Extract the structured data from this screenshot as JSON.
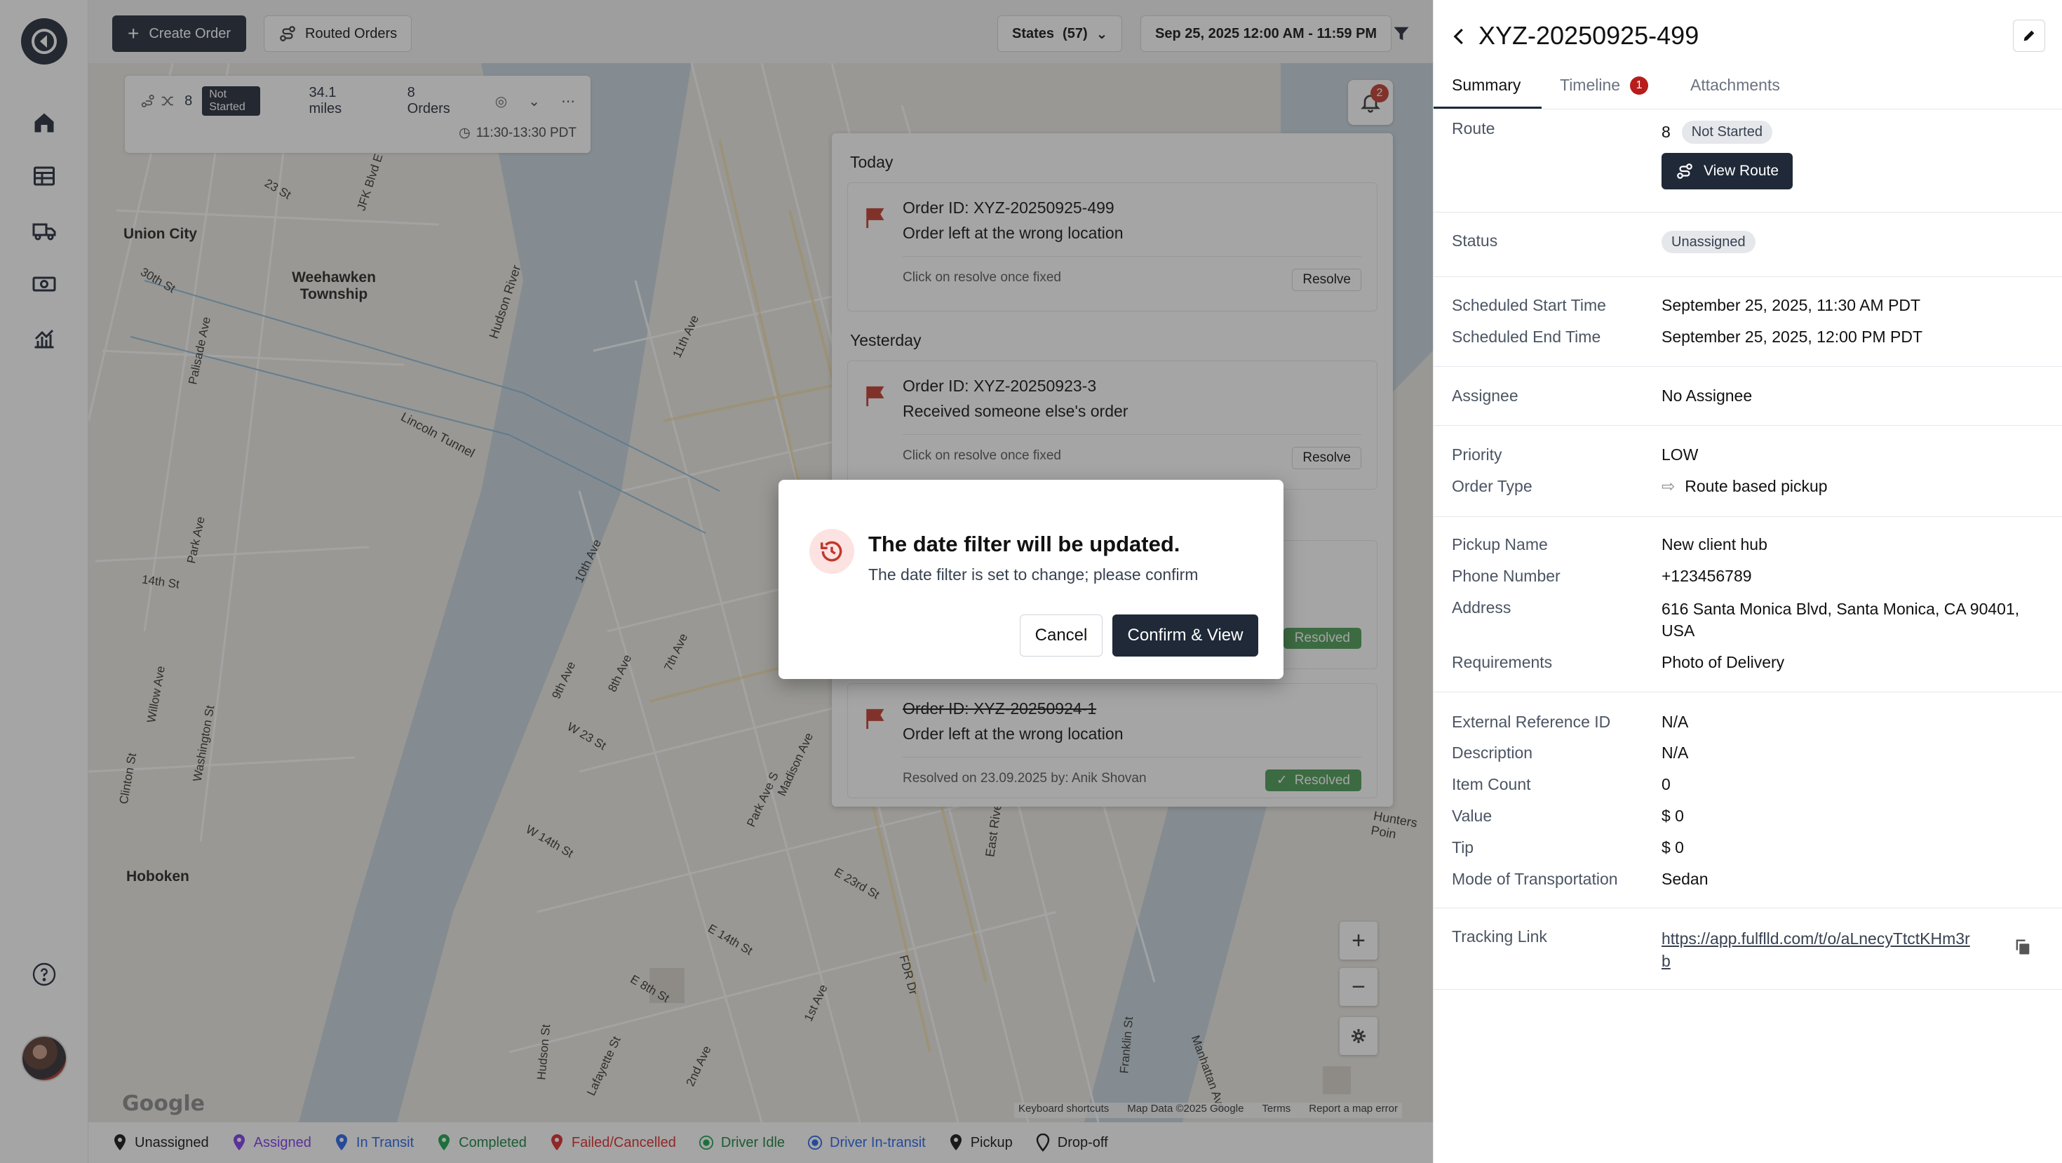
{
  "toolbar": {
    "create_order": "Create Order",
    "routed_orders": "Routed Orders",
    "states_label": "States",
    "states_count": "(57)",
    "date_range": "Sep 25, 2025 12:00 AM - 11:59 PM"
  },
  "route_card": {
    "route_number": "8",
    "status": "Not Started",
    "distance": "34.1 miles",
    "orders": "8 Orders",
    "time_window": "11:30-13:30 PDT"
  },
  "notifications": {
    "count": "2",
    "groups": [
      {
        "label": "Today"
      },
      {
        "label": "Yesterday"
      }
    ],
    "items": [
      {
        "order_id": "Order ID: XYZ-20250925-499",
        "message": "Order left at the wrong location",
        "hint": "Click on resolve once fixed",
        "action": "Resolve"
      },
      {
        "order_id": "Order ID: XYZ-20250923-3",
        "message": "Received someone else's order",
        "hint": "Click on resolve once fixed",
        "action": "Resolve"
      },
      {
        "status": "Resolved"
      },
      {
        "order_id": "Order ID: XYZ-20250924-1",
        "message": "Order left at the wrong location",
        "hint": "Resolved on 23.09.2025 by: Anik Shovan",
        "status": "Resolved"
      }
    ]
  },
  "map": {
    "places": [
      "Union City",
      "Weehawken Township",
      "Hoboken",
      "Hudson River",
      "Lincoln Tunnel",
      "East River",
      "Hunters Poin"
    ],
    "streets": [
      "11th Ave",
      "10th Ave",
      "9th Ave",
      "8th Ave",
      "7th Ave",
      "Madison Ave",
      "Park Ave S",
      "1st Ave",
      "2nd Ave",
      "Lafayette St",
      "E 23rd St",
      "E 14th St",
      "E 8th St",
      "W 23 St",
      "W 14th St",
      "14th St",
      "30th St",
      "Palisade Ave",
      "Park Ave",
      "Willow Ave",
      "Washington St",
      "Clinton St",
      "Hudson St",
      "JFK Blvd E",
      "23 St",
      "FDR Dr",
      "Franklin St",
      "Manhattan Ave"
    ],
    "zoom_in": "+",
    "zoom_out": "−",
    "google": "Google",
    "attribution": [
      "Keyboard shortcuts",
      "Map Data ©2025 Google",
      "Terms",
      "Report a map error"
    ]
  },
  "legend": [
    {
      "label": "Unassigned",
      "color": "#111111"
    },
    {
      "label": "Assigned",
      "color": "#7c3aed"
    },
    {
      "label": "In Transit",
      "color": "#2563eb"
    },
    {
      "label": "Completed",
      "color": "#16a34a"
    },
    {
      "label": "Failed/Cancelled",
      "color": "#dc2626"
    },
    {
      "label": "Driver Idle",
      "color": "#16a34a"
    },
    {
      "label": "Driver In-transit",
      "color": "#2563eb"
    },
    {
      "label": "Pickup",
      "color": "#111111"
    },
    {
      "label": "Drop-off",
      "color": "#111111"
    }
  ],
  "modal": {
    "title": "The date filter will be updated.",
    "subtitle": "The date filter is set to change; please confirm",
    "cancel": "Cancel",
    "confirm": "Confirm & View"
  },
  "detail": {
    "title": "XYZ-20250925-499",
    "tabs": [
      {
        "label": "Summary"
      },
      {
        "label": "Timeline",
        "count": "1"
      },
      {
        "label": "Attachments"
      }
    ],
    "route_label": "Route",
    "route_number": "8",
    "route_status": "Not Started",
    "view_route": "View Route",
    "status_label": "Status",
    "status_value": "Unassigned",
    "fields": [
      {
        "label": "Scheduled Start Time",
        "value": "September 25, 2025, 11:30 AM PDT"
      },
      {
        "label": "Scheduled End Time",
        "value": "September 25, 2025, 12:00 PM PDT"
      },
      {
        "label": "Assignee",
        "value": "No Assignee"
      },
      {
        "label": "Priority",
        "value": "LOW"
      },
      {
        "label": "Order Type",
        "value": "Route based pickup"
      },
      {
        "label": "Pickup Name",
        "value": "New client hub"
      },
      {
        "label": "Phone Number",
        "value": "+123456789"
      },
      {
        "label": "Address",
        "value": "616 Santa Monica Blvd, Santa Monica, CA 90401,",
        "value2": "USA"
      },
      {
        "label": "Requirements",
        "value": "Photo of Delivery"
      },
      {
        "label": "External Reference ID",
        "value": "N/A"
      },
      {
        "label": "Description",
        "value": "N/A"
      },
      {
        "label": "Item Count",
        "value": "0"
      },
      {
        "label": "Value",
        "value": "$ 0"
      },
      {
        "label": "Tip",
        "value": "$ 0"
      },
      {
        "label": "Mode of Transportation",
        "value": "Sedan"
      },
      {
        "label": "Tracking Link",
        "value": "https://app.fulflld.com/t/o/aLnecyTtctKHm3r",
        "value2": "b"
      }
    ]
  }
}
